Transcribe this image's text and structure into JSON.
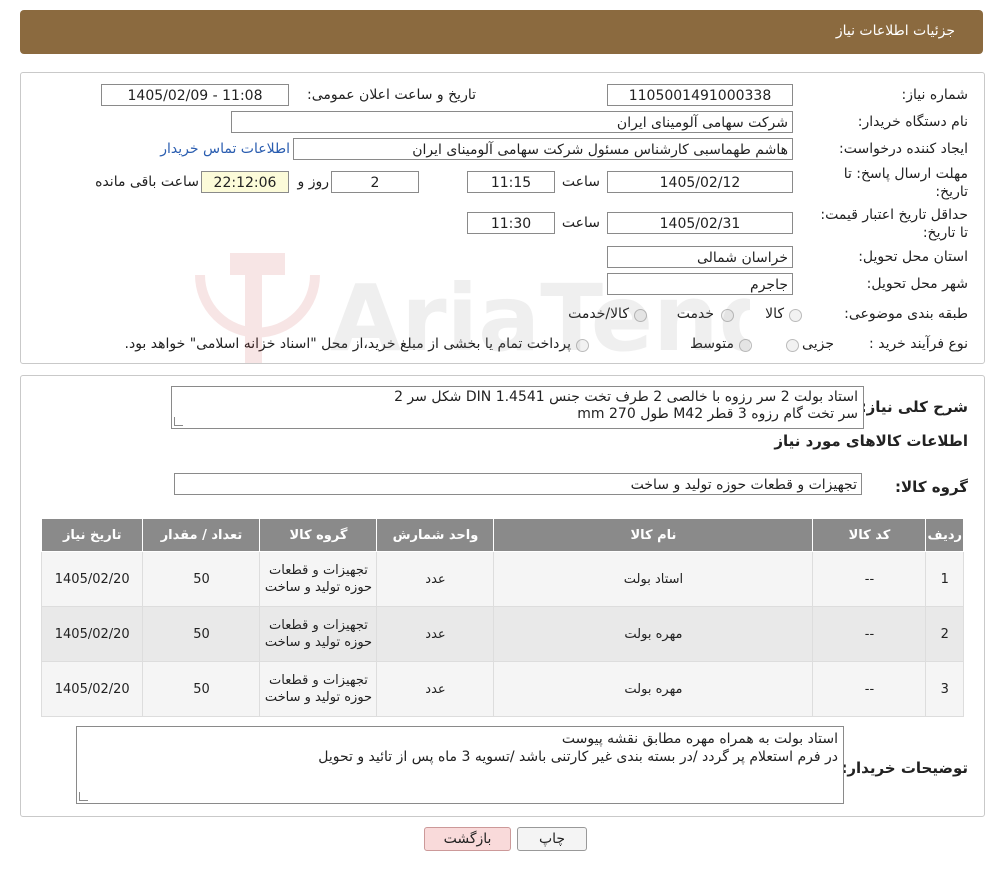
{
  "header": {
    "title": "جزئیات اطلاعات نیاز"
  },
  "form": {
    "need_number_label": "شماره نیاز:",
    "need_number": "1105001491000338",
    "announce_label": "تاریخ و ساعت اعلان عمومی:",
    "announce_value": "1405/02/09 - 11:08",
    "buyer_org_label": "نام دستگاه خریدار:",
    "buyer_org": "شرکت سهامی آلومینای ایران",
    "creator_label": "ایجاد کننده درخواست:",
    "creator": "هاشم طهماسبی کارشناس مسئول شرکت سهامی آلومینای ایران",
    "contact_link": "اطلاعات تماس خریدار",
    "deadline_label": "مهلت ارسال پاسخ: تا تاریخ:",
    "deadline_date": "1405/02/12",
    "time_label": "ساعت",
    "deadline_time": "11:15",
    "days_value": "2",
    "days_label": "روز و",
    "remaining_time": "22:12:06",
    "remaining_label": "ساعت باقی مانده",
    "validity_label": "حداقل تاریخ اعتبار قیمت: تا تاریخ:",
    "validity_date": "1405/02/31",
    "validity_time": "11:30",
    "province_label": "استان محل تحویل:",
    "province": "خراسان شمالی",
    "city_label": "شهر محل تحویل:",
    "city": "جاجرم",
    "category_label": "طبقه بندی موضوعی:",
    "category_options": [
      "کالا",
      "خدمت",
      "کالا/خدمت"
    ],
    "process_label": "نوع فرآیند خرید :",
    "process_options": [
      "جزیی",
      "متوسط"
    ],
    "process_note": "پرداخت تمام یا بخشی از مبلغ خرید،از محل \"اسناد خزانه اسلامی\" خواهد بود."
  },
  "details": {
    "summary_label": "شرح کلی نیاز:",
    "summary_line1": "استاد بولت 2 سر رزوه با خالصی 2 طرف تخت جنس DIN 1.4541 شکل سر 2",
    "summary_line2": "سر تخت گام رزوه 3 قطر M42 طول 270 mm",
    "goods_info_title": "اطلاعات کالاهای مورد نیاز",
    "goods_group_label": "گروه کالا:",
    "goods_group": "تجهیزات و قطعات حوزه تولید و ساخت"
  },
  "table": {
    "headers": [
      "ردیف",
      "کد کالا",
      "نام کالا",
      "واحد شمارش",
      "گروه کالا",
      "تعداد / مقدار",
      "تاریخ نیاز"
    ],
    "rows": [
      [
        "1",
        "--",
        "استاد بولت",
        "عدد",
        "تجهیزات و قطعات حوزه تولید و ساخت",
        "50",
        "1405/02/20"
      ],
      [
        "2",
        "--",
        "مهره بولت",
        "عدد",
        "تجهیزات و قطعات حوزه تولید و ساخت",
        "50",
        "1405/02/20"
      ],
      [
        "3",
        "--",
        "مهره بولت",
        "عدد",
        "تجهیزات و قطعات حوزه تولید و ساخت",
        "50",
        "1405/02/20"
      ]
    ]
  },
  "buyer_notes": {
    "label": "توضیحات خریدار:",
    "line1": "استاد بولت به همراه مهره مطابق نقشه پیوست",
    "line2": "در فرم استعلام پر گردد /در بسته بندی غیر کارتنی باشد /تسویه 3 ماه پس از تائید و تحویل"
  },
  "buttons": {
    "print": "چاپ",
    "back": "بازگشت"
  },
  "watermark": {
    "text": "AriaTender.neT"
  },
  "colors": {
    "header_bg": "#8b6a3f",
    "table_header": "#8a8a8a",
    "link": "#2a5db0",
    "back_button": "#f9dada"
  }
}
